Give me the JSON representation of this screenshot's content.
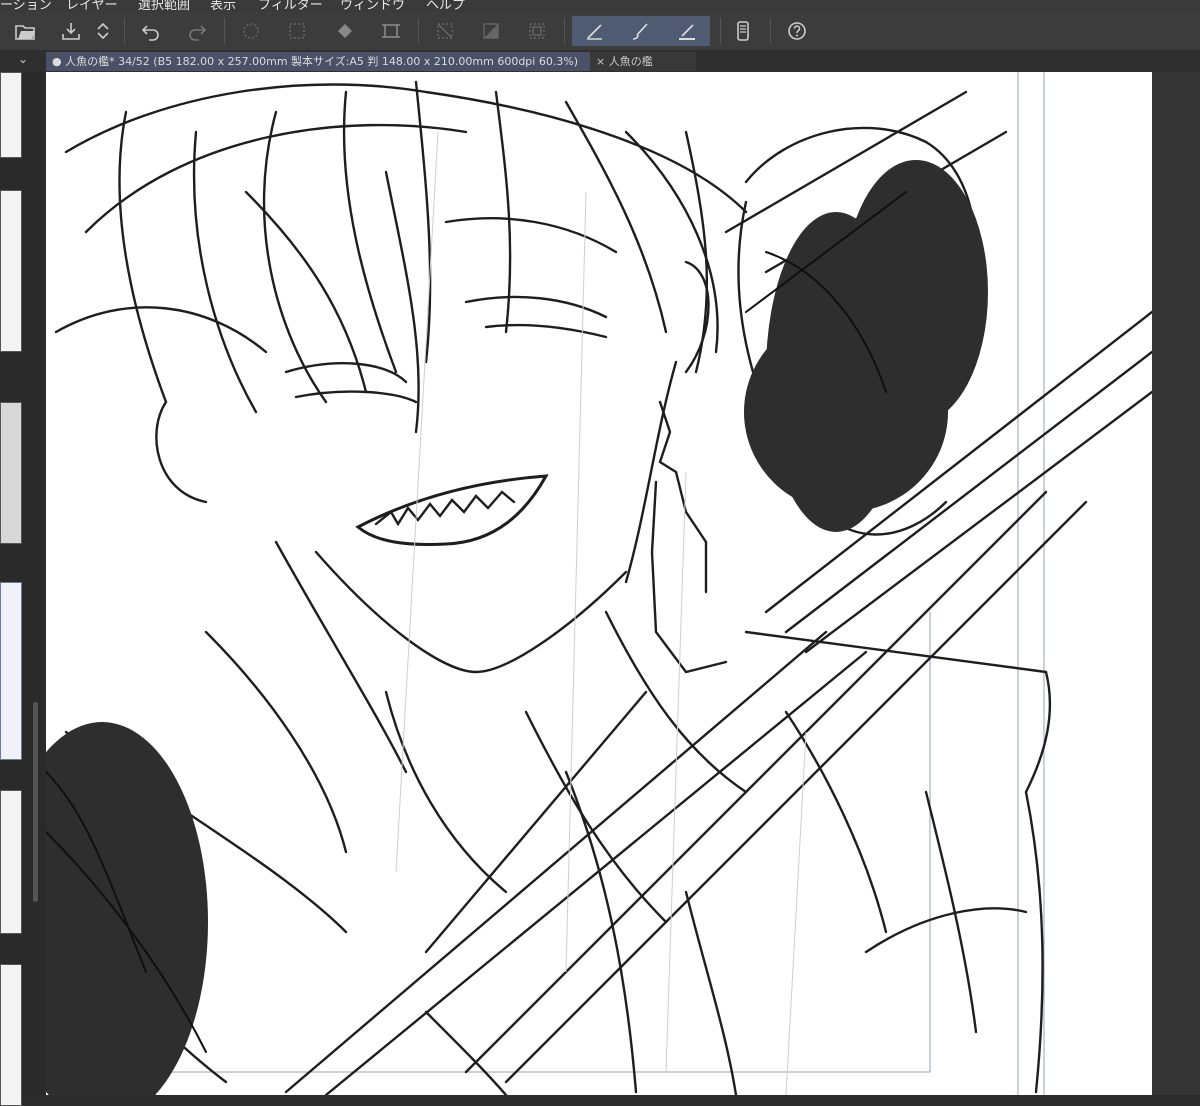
{
  "menu": [
    "ーション",
    "レイヤー",
    "選択範囲",
    "表示",
    "フィルター",
    "ウィンドウ",
    "ヘルプ"
  ],
  "toolbar": {
    "buttons": [
      "open-icon",
      "save-icon",
      "scroll-icon",
      "undo-icon",
      "redo-icon",
      "clear-selection-icon",
      "selection-icon",
      "fill-icon",
      "transform-icon",
      "erase-outside-icon",
      "invert-selection-icon",
      "border-icon",
      "pen-icon",
      "brush-icon",
      "ruler-pen-icon",
      "smartphone-icon",
      "help-icon"
    ]
  },
  "tabs": {
    "active_label": "● 人魚の檻* 34/52 (B5 182.00 x 257.00mm 製本サイズ:A5 判 148.00 x 210.00mm 600dpi 60.3%)",
    "second_label": "× 人魚の檻"
  },
  "colors": {
    "active_tab": "#4a5066",
    "active_tool": "#4f5b73",
    "blob": "#2e2e2e"
  }
}
